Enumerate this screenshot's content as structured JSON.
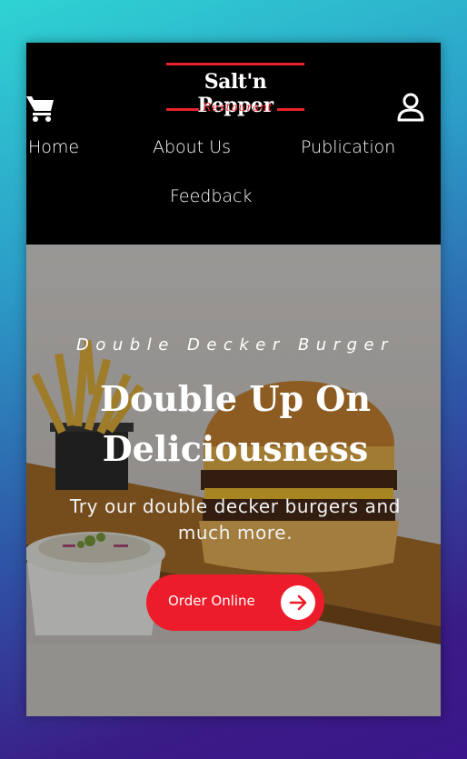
{
  "brand": {
    "name": "Salt'n Pepper",
    "subtitle": "Restaurant",
    "accent_color": "#e8232c"
  },
  "header": {
    "cart_icon": "shopping-cart-icon",
    "account_icon": "user-icon"
  },
  "nav": {
    "items": [
      {
        "label": "Home"
      },
      {
        "label": "About Us"
      },
      {
        "label": "Publication"
      },
      {
        "label": "Feedback"
      }
    ]
  },
  "hero": {
    "eyebrow": "Double Decker Burger",
    "headline_line1": "Double Up On",
    "headline_line2": "Deliciousness",
    "tagline": "Try our double decker burgers and much more.",
    "cta_label": "Order Online",
    "cta_icon": "arrow-right-icon",
    "cta_color": "#ec1c2b"
  }
}
